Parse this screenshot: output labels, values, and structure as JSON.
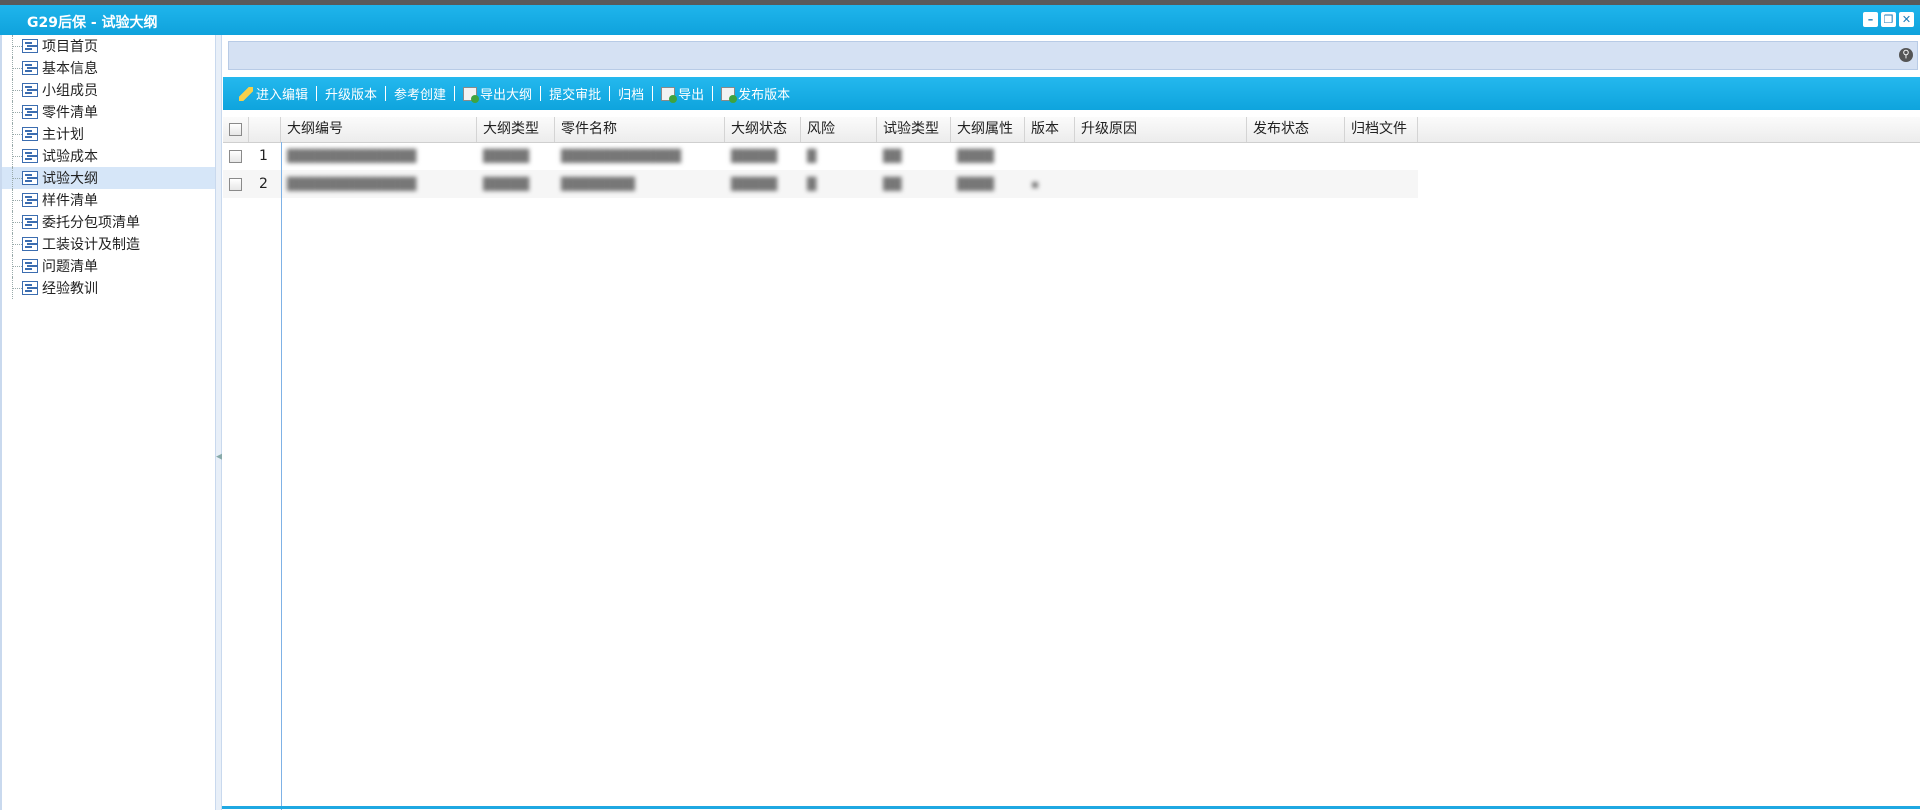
{
  "window": {
    "title": "G29后保 - 试验大纲",
    "controls": [
      "minimize-icon",
      "restore-icon",
      "close-icon"
    ]
  },
  "sidebar": {
    "selected_index": 6,
    "items": [
      {
        "label": "项目首页"
      },
      {
        "label": "基本信息"
      },
      {
        "label": "小组成员"
      },
      {
        "label": "零件清单"
      },
      {
        "label": "主计划"
      },
      {
        "label": "试验成本"
      },
      {
        "label": "试验大纲"
      },
      {
        "label": "样件清单"
      },
      {
        "label": "委托分包项清单"
      },
      {
        "label": "工装设计及制造"
      },
      {
        "label": "问题清单"
      },
      {
        "label": "经验教训"
      }
    ]
  },
  "search": {
    "icon": "search-icon"
  },
  "toolbar": {
    "buttons": [
      {
        "label": "进入编辑",
        "icon": "pencil-icon"
      },
      {
        "label": "升级版本",
        "icon": ""
      },
      {
        "label": "参考创建",
        "icon": ""
      },
      {
        "label": "导出大纲",
        "icon": "export-icon"
      },
      {
        "label": "提交审批",
        "icon": ""
      },
      {
        "label": "归档",
        "icon": ""
      },
      {
        "label": "导出",
        "icon": "export-icon"
      },
      {
        "label": "发布版本",
        "icon": "publish-icon"
      }
    ]
  },
  "grid": {
    "columns": [
      "大纲编号",
      "大纲类型",
      "零件名称",
      "大纲状态",
      "风险",
      "试验类型",
      "大纲属性",
      "版本",
      "升级原因",
      "发布状态",
      "归档文件"
    ],
    "rows": [
      {
        "num": "1",
        "cells": [
          "██████████████",
          "█████",
          "█████████████",
          "█████",
          "█",
          "██",
          "████",
          "",
          "",
          "",
          ""
        ]
      },
      {
        "num": "2",
        "cells": [
          "██████████████",
          "█████",
          "████████",
          "█████",
          "█",
          "██",
          "████",
          "▪",
          "",
          "",
          ""
        ]
      }
    ]
  }
}
